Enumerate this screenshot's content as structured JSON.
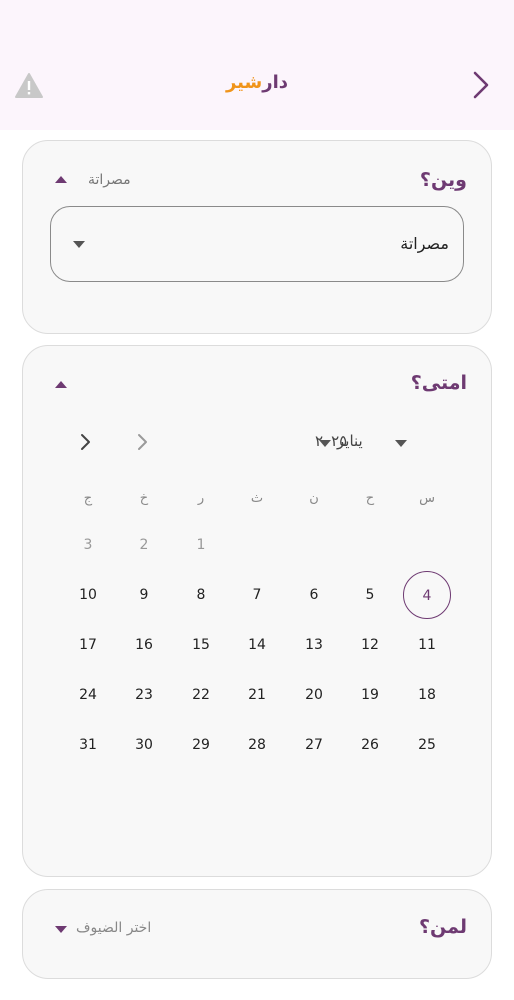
{
  "header": {
    "logo_part1": "دار",
    "logo_part2": "شير",
    "colors": {
      "brand_purple": "#6e3a72",
      "brand_orange": "#f0941a",
      "header_bg": "#fcf5fc"
    },
    "back_icon": "chevron-right-icon",
    "warning_icon": "warning-icon"
  },
  "where": {
    "title": "وين؟",
    "summary": "مصراتة",
    "dropdown_value": "مصراتة"
  },
  "when": {
    "title": "امتى؟",
    "month_label": "يناير",
    "year_label": "٢٠٢٥",
    "weekdays": [
      "س",
      "ح",
      "ن",
      "ث",
      "ر",
      "خ",
      "ج"
    ],
    "selected_day": "4",
    "weeks": [
      [
        "",
        "",
        "",
        "",
        "1",
        "2",
        "3"
      ],
      [
        "4",
        "5",
        "6",
        "7",
        "8",
        "9",
        "10"
      ],
      [
        "11",
        "12",
        "13",
        "14",
        "15",
        "16",
        "17"
      ],
      [
        "18",
        "19",
        "20",
        "21",
        "22",
        "23",
        "24"
      ],
      [
        "25",
        "26",
        "27",
        "28",
        "29",
        "30",
        "31"
      ]
    ]
  },
  "who": {
    "title": "لمن؟",
    "placeholder": "اختر الضيوف"
  }
}
